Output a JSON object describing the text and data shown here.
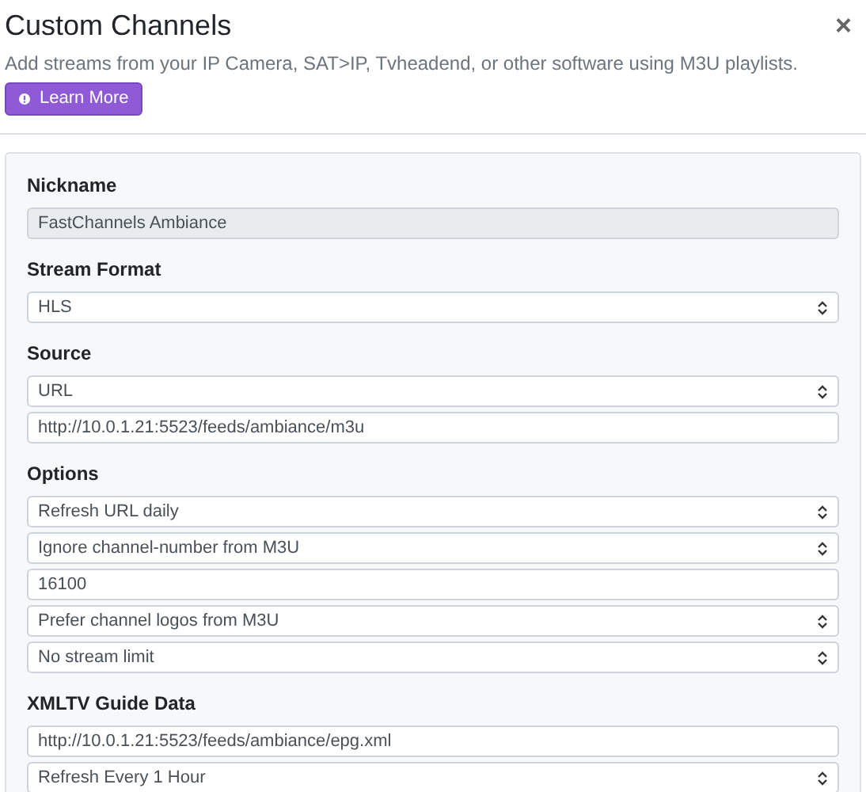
{
  "header": {
    "title": "Custom Channels",
    "close": "×",
    "description": "Add streams from your IP Camera, SAT>IP, Tvheadend, or other software using M3U playlists.",
    "learn_more": "Learn More"
  },
  "sections": [
    {
      "label": "Nickname",
      "fields": [
        {
          "kind": "text",
          "value": "FastChannels Ambiance",
          "disabled": true
        }
      ]
    },
    {
      "label": "Stream Format",
      "fields": [
        {
          "kind": "select",
          "value": "HLS"
        }
      ]
    },
    {
      "label": "Source",
      "fields": [
        {
          "kind": "select",
          "value": "URL"
        },
        {
          "kind": "text",
          "value": "http://10.0.1.21:5523/feeds/ambiance/m3u",
          "disabled": false
        }
      ]
    },
    {
      "label": "Options",
      "fields": [
        {
          "kind": "select",
          "value": "Refresh URL daily"
        },
        {
          "kind": "select",
          "value": "Ignore channel-number from M3U"
        },
        {
          "kind": "text",
          "value": "16100",
          "disabled": false
        },
        {
          "kind": "select",
          "value": "Prefer channel logos from M3U"
        },
        {
          "kind": "select",
          "value": "No stream limit"
        }
      ]
    },
    {
      "label": "XMLTV Guide Data",
      "fields": [
        {
          "kind": "text",
          "value": "http://10.0.1.21:5523/feeds/ambiance/epg.xml",
          "disabled": false
        },
        {
          "kind": "select",
          "value": "Refresh Every 1 Hour"
        }
      ]
    }
  ]
}
